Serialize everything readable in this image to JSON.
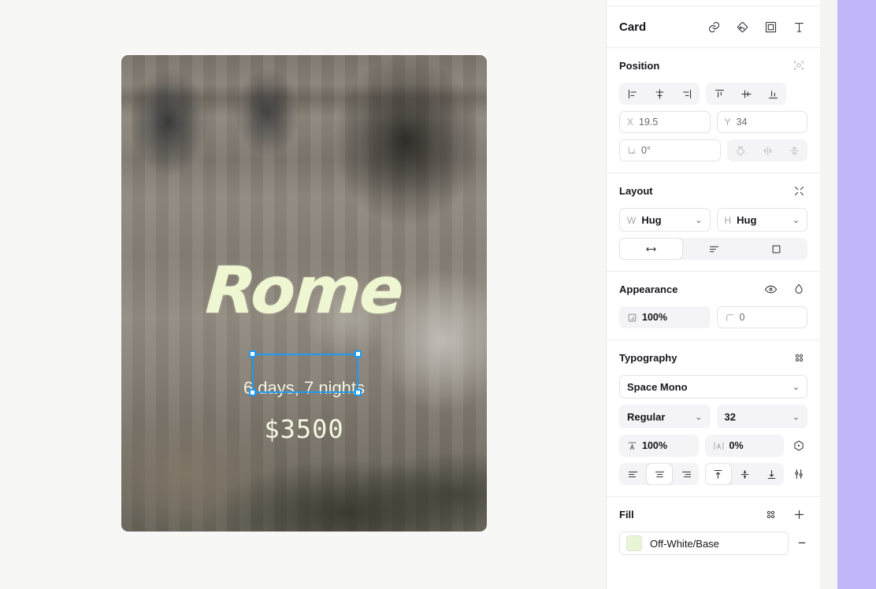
{
  "canvas": {
    "card": {
      "title": "Rome",
      "subtitle": "6 days, 7 nights",
      "price": "$3500",
      "image_alt": "trevi-fountain-photo"
    }
  },
  "panel": {
    "header": {
      "title": "Card",
      "icons": [
        "link-icon",
        "component-icon",
        "frame-icon",
        "text-icon"
      ]
    },
    "position": {
      "title": "Position",
      "align_icon": "align-to-selection-icon",
      "h_align": [
        "align-left",
        "align-horizontal-center",
        "align-right"
      ],
      "v_align": [
        "align-top",
        "align-vertical-center",
        "align-bottom"
      ],
      "x_label": "X",
      "x_value": "19.5",
      "y_label": "Y",
      "y_value": "34",
      "rotation_value": "0°",
      "transform_buttons": [
        "rotate-icon",
        "flip-horizontal-icon",
        "flip-vertical-icon"
      ]
    },
    "layout": {
      "title": "Layout",
      "collapse_icon": "collapse-icon",
      "w_label": "W",
      "w_value": "Hug",
      "h_label": "H",
      "h_value": "Hug",
      "mode_buttons": [
        "horizontal-resize-icon",
        "text-wrap-icon",
        "clip-content-icon"
      ]
    },
    "appearance": {
      "title": "Appearance",
      "visibility_icon": "eye-icon",
      "blend_icon": "droplet-icon",
      "opacity_value": "100%",
      "corner_value": "0"
    },
    "typography": {
      "title": "Typography",
      "styles_icon": "styles-icon",
      "font_family": "Space Mono",
      "font_weight": "Regular",
      "font_size": "32",
      "line_height_value": "100%",
      "letter_spacing_value": "0%",
      "detail_icon": "type-detail-icon",
      "text_align": [
        "align-text-left",
        "align-text-center",
        "align-text-right"
      ],
      "text_align_selected": 1,
      "vertical_align": [
        "align-text-top",
        "align-text-middle",
        "align-text-bottom"
      ],
      "vertical_align_selected": 0,
      "settings_icon": "type-settings-icon"
    },
    "fill": {
      "title": "Fill",
      "styles_icon": "styles-icon",
      "add_icon": "plus-icon",
      "swatch_color": "#e9f5d4",
      "name": "Off-White/Base",
      "remove_icon": "minus-icon"
    }
  },
  "colors": {
    "selection_blue": "#1e9af3",
    "edge_strip_purple": "#c1b6f7",
    "canvas_bg": "#f7f7f6",
    "card_text": "#eef7d2"
  }
}
